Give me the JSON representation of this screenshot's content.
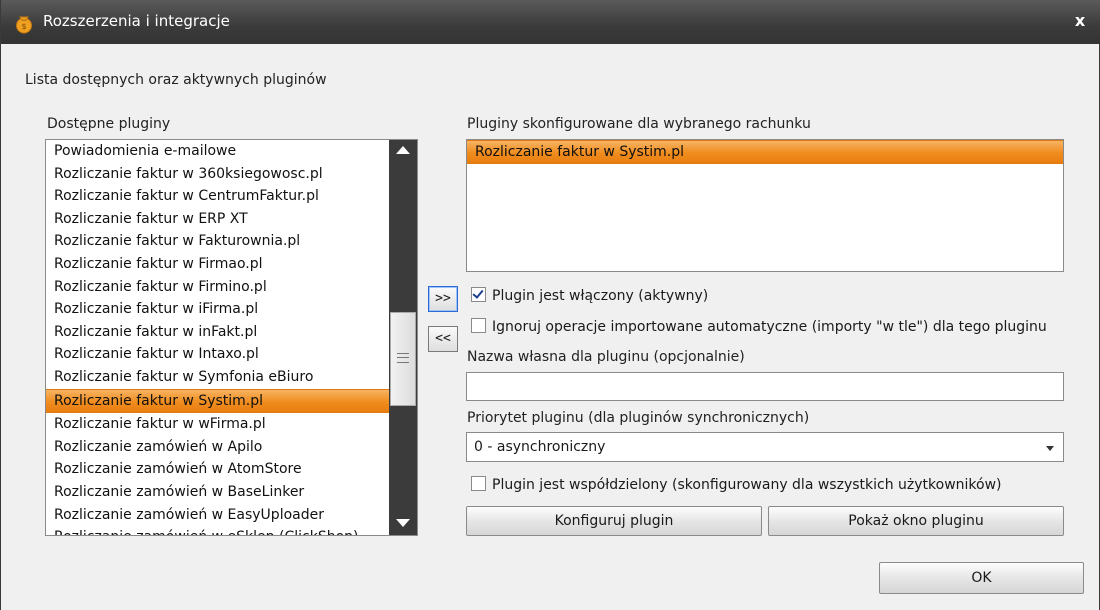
{
  "window": {
    "title": "Rozszerzenia i integracje",
    "close_label": "x"
  },
  "header_label": "Lista dostępnych oraz aktywnych pluginów",
  "available": {
    "label": "Dostępne pluginy",
    "items": [
      "Powiadomienia e-mailowe",
      "Rozliczanie faktur w 360ksiegowosc.pl",
      "Rozliczanie faktur w CentrumFaktur.pl",
      "Rozliczanie faktur w ERP XT",
      "Rozliczanie faktur w Fakturownia.pl",
      "Rozliczanie faktur w Firmao.pl",
      "Rozliczanie faktur w Firmino.pl",
      "Rozliczanie faktur w iFirma.pl",
      "Rozliczanie faktur w inFakt.pl",
      "Rozliczanie faktur w Intaxo.pl",
      "Rozliczanie faktur w Symfonia eBiuro",
      "Rozliczanie faktur w Systim.pl",
      "Rozliczanie faktur w wFirma.pl",
      "Rozliczanie zamówień w Apilo",
      "Rozliczanie zamówień w AtomStore",
      "Rozliczanie zamówień w BaseLinker",
      "Rozliczanie zamówień w EasyUploader",
      "Rozliczanie zamówień w eSklep (ClickShop)"
    ],
    "selected_index": 11
  },
  "move_buttons": {
    "add": ">>",
    "remove": "<<"
  },
  "configured": {
    "label": "Pluginy skonfigurowane dla wybranego rachunku",
    "items": [
      "Rozliczanie faktur w Systim.pl"
    ]
  },
  "options": {
    "enabled_label": "Plugin jest włączony (aktywny)",
    "enabled_checked": true,
    "ignore_label": "Ignoruj operacje importowane automatyczne (importy \"w tle\") dla tego pluginu",
    "ignore_checked": false,
    "custom_name_label": "Nazwa własna dla pluginu (opcjonalnie)",
    "custom_name_value": "",
    "priority_label": "Priorytet pluginu (dla pluginów synchronicznych)",
    "priority_value": "0 - asynchroniczny",
    "shared_label": "Plugin jest współdzielony (skonfigurowany dla wszystkich użytkowników)",
    "shared_checked": false
  },
  "buttons": {
    "configure": "Konfiguruj plugin",
    "show_window": "Pokaż okno pluginu",
    "ok": "OK"
  }
}
